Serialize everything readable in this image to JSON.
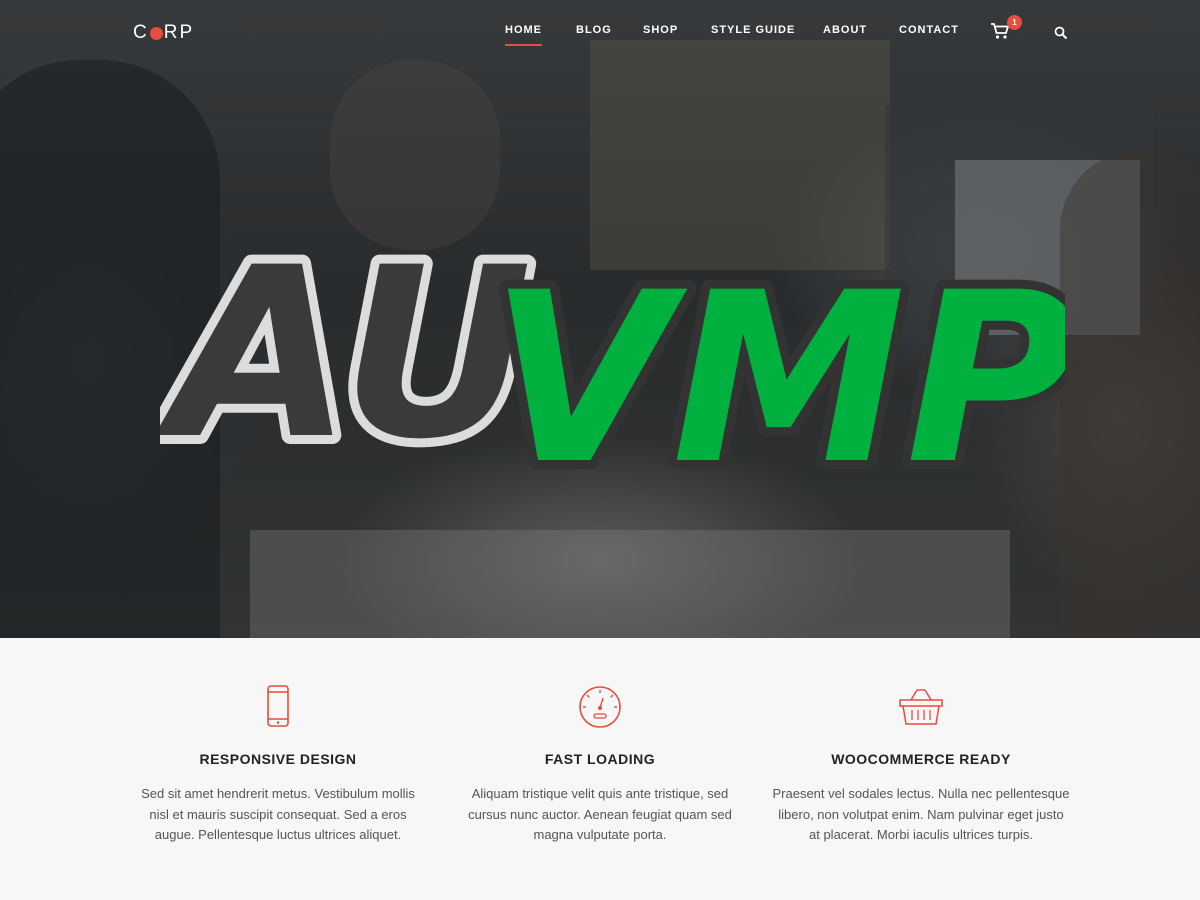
{
  "header": {
    "logo": {
      "left": "C",
      "right": "RP"
    },
    "menu": [
      {
        "label": "HOME",
        "active": true
      },
      {
        "label": "BLOG",
        "active": false
      },
      {
        "label": "SHOP",
        "active": false
      },
      {
        "label": "STYLE GUIDE",
        "active": false
      },
      {
        "label": "ABOUT",
        "active": false
      },
      {
        "label": "CONTACT",
        "active": false
      }
    ],
    "cart_count": "1",
    "icons": {
      "cart": "cart-icon",
      "search": "search-icon"
    }
  },
  "watermark": {
    "text": "AUVMP",
    "part1": "AU",
    "part2": "VMP"
  },
  "features": [
    {
      "icon": "mobile-phone-icon",
      "title": "RESPONSIVE DESIGN",
      "lines": [
        "Sed sit amet hendrerit metus. Vestibulum mollis",
        "nisl et mauris suscipit consequat. Sed a eros",
        "augue. Pellentesque luctus ultrices aliquet."
      ]
    },
    {
      "icon": "speedometer-icon",
      "title": "FAST LOADING",
      "lines": [
        "Aliquam tristique velit quis ante tristique, sed",
        "cursus nunc auctor. Aenean feugiat quam sed",
        "magna vulputate porta."
      ]
    },
    {
      "icon": "shopping-basket-icon",
      "title": "WOOCOMMERCE READY",
      "lines": [
        "Praesent vel sodales lectus. Nulla nec pellentesque",
        "libero, non volutpat enim. Nam pulvinar eget justo",
        "at placerat. Morbi iaculis ultrices turpis."
      ]
    }
  ],
  "colors": {
    "accent": "#e74c3c",
    "watermark_green": "#00b140",
    "watermark_dark": "#3a3a3a"
  }
}
